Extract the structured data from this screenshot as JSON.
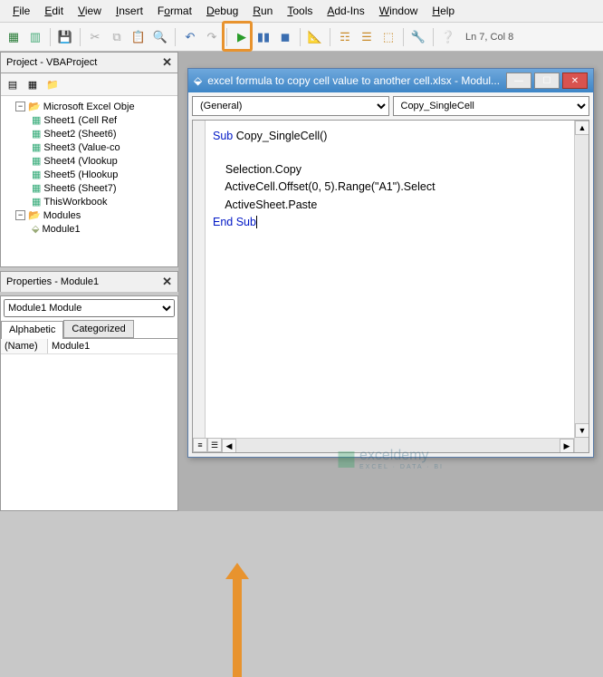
{
  "menu": [
    "File",
    "Edit",
    "View",
    "Insert",
    "Format",
    "Debug",
    "Run",
    "Tools",
    "Add-Ins",
    "Window",
    "Help"
  ],
  "status": "Ln 7, Col 8",
  "project_pane": {
    "title": "Project - VBAProject",
    "root": "Microsoft Excel Obje",
    "sheets": [
      "Sheet1 (Cell Ref",
      "Sheet2 (Sheet6)",
      "Sheet3 (Value-co",
      "Sheet4 (Vlookup",
      "Sheet5 (Hlookup",
      "Sheet6 (Sheet7)",
      "ThisWorkbook"
    ],
    "modules_label": "Modules",
    "module": "Module1"
  },
  "properties_pane": {
    "title": "Properties - Module1",
    "combo": "Module1 Module",
    "tabs": [
      "Alphabetic",
      "Categorized"
    ],
    "rows": [
      {
        "k": "(Name)",
        "v": "Module1"
      }
    ]
  },
  "code_window": {
    "title": "excel formula to copy cell value to another cell.xlsx - Modul...",
    "dd_left": "(General)",
    "dd_right": "Copy_SingleCell",
    "code": {
      "l1_kw": "Sub",
      "l1_rest": " Copy_SingleCell()",
      "l2": "    Selection.Copy",
      "l3": "    ActiveCell.Offset(0, 5).Range(\"A1\").Select",
      "l4": "    ActiveSheet.Paste",
      "l5_kw": "End Sub"
    }
  },
  "watermark": {
    "name": "exceldemy",
    "tag": "EXCEL · DATA · BI"
  }
}
